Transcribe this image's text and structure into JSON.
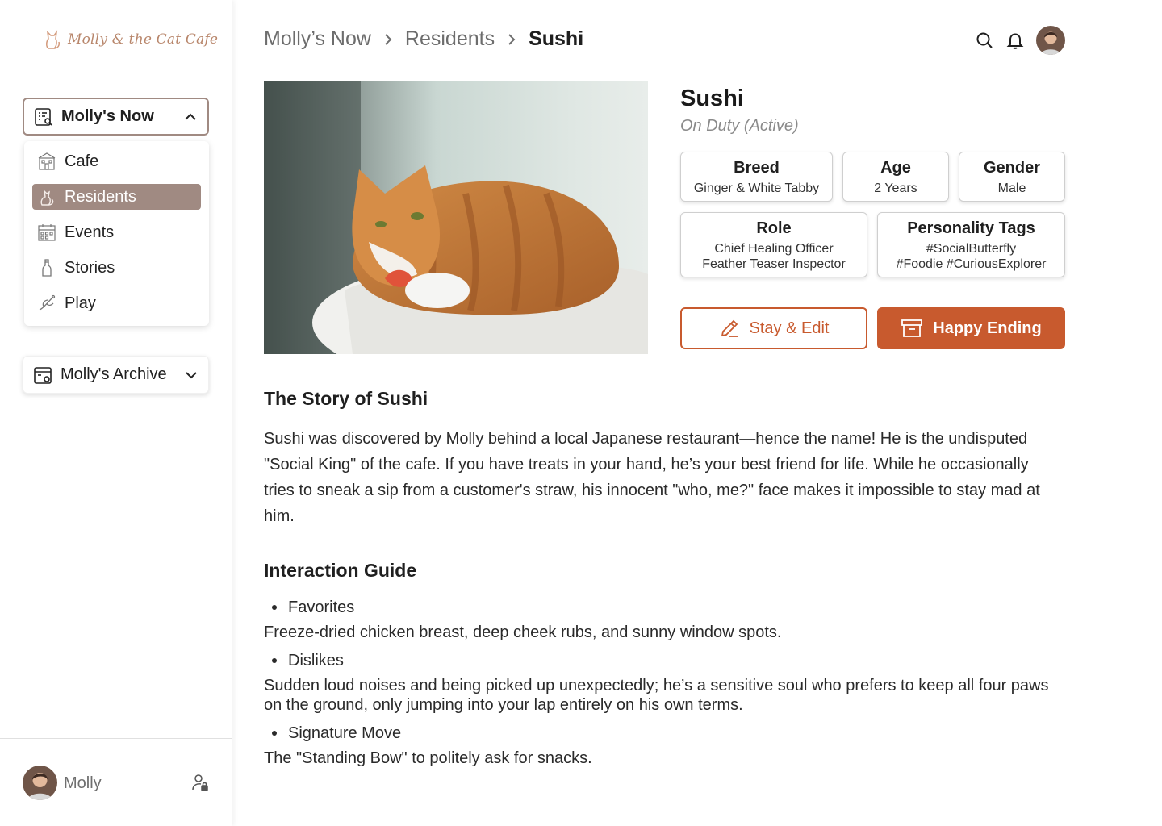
{
  "brand": {
    "name": "Molly & the Cat Cafe"
  },
  "sidebar": {
    "sections": [
      {
        "label": "Molly's Now",
        "expanded": true,
        "icon": "list-search-icon"
      },
      {
        "label": "Molly's Archive",
        "expanded": false,
        "icon": "archive-box-icon"
      }
    ],
    "items": [
      {
        "label": "Cafe",
        "icon": "cafe-building-icon",
        "active": false
      },
      {
        "label": "Residents",
        "icon": "cat-icon",
        "active": true
      },
      {
        "label": "Events",
        "icon": "calendar-icon",
        "active": false
      },
      {
        "label": "Stories",
        "icon": "bottle-icon",
        "active": false
      },
      {
        "label": "Play",
        "icon": "feather-toy-icon",
        "active": false
      }
    ],
    "user": {
      "name": "Molly"
    }
  },
  "breadcrumb": [
    "Molly’s Now",
    "Residents",
    "Sushi"
  ],
  "profile": {
    "name": "Sushi",
    "status": "On Duty (Active)",
    "breed": {
      "title": "Breed",
      "value": "Ginger & White Tabby"
    },
    "age": {
      "title": "Age",
      "value": "2 Years"
    },
    "gender": {
      "title": "Gender",
      "value": "Male"
    },
    "role": {
      "title": "Role",
      "line1": "Chief Healing Officer",
      "line2": "Feather Teaser Inspector"
    },
    "tags": {
      "title": "Personality Tags",
      "line1": "#SocialButterfly",
      "line2": "#Foodie #CuriousExplorer"
    }
  },
  "actions": {
    "edit_label": "Stay & Edit",
    "happy_label": "Happy Ending"
  },
  "story": {
    "title": "The Story of Sushi",
    "text": "Sushi was discovered by Molly behind a local Japanese restaurant—hence the name! He is the undisputed \"Social King\" of the cafe. If you have treats in your hand, he’s your best friend for life. While he occasionally tries to sneak a sip from a customer's straw, his innocent \"who, me?\" face makes it impossible to stay mad at him."
  },
  "guide": {
    "title": "Interaction Guide",
    "items": [
      {
        "label": "Favorites",
        "text": "Freeze-dried chicken breast, deep cheek rubs, and sunny window spots."
      },
      {
        "label": "Dislikes",
        "text": "Sudden loud noises and being picked up unexpectedly; he’s a sensitive soul who prefers to keep all four paws on the ground, only jumping into your lap entirely on his own terms."
      },
      {
        "label": "Signature Move",
        "text": "The \"Standing Bow\" to politely ask for snacks."
      }
    ]
  },
  "colors": {
    "accent": "#c85a2e",
    "nav_active": "#a08a82",
    "logo": "#b8866b"
  }
}
